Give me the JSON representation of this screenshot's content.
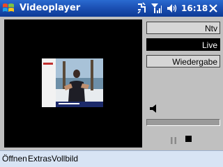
{
  "window": {
    "title": "Videoplayer",
    "clock": "16:18"
  },
  "channels": [
    {
      "label": "Ntv",
      "selected": false
    },
    {
      "label": "Live",
      "selected": true
    },
    {
      "label": "Wiedergabe",
      "selected": false
    }
  ],
  "menu": [
    {
      "label": "Öffnen"
    },
    {
      "label": "Extras"
    },
    {
      "label": "Vollbild"
    }
  ],
  "colors": {
    "titlebar": "#1b4fb2",
    "menubar": "#d8e4f4",
    "video_bg": "#000000",
    "selected_channel_bg": "#000000"
  },
  "icons": [
    "windows-flag-icon",
    "network-icon",
    "signal-icon",
    "volume-icon",
    "close-icon",
    "speaker-icon",
    "pause-icon",
    "stop-icon"
  ]
}
